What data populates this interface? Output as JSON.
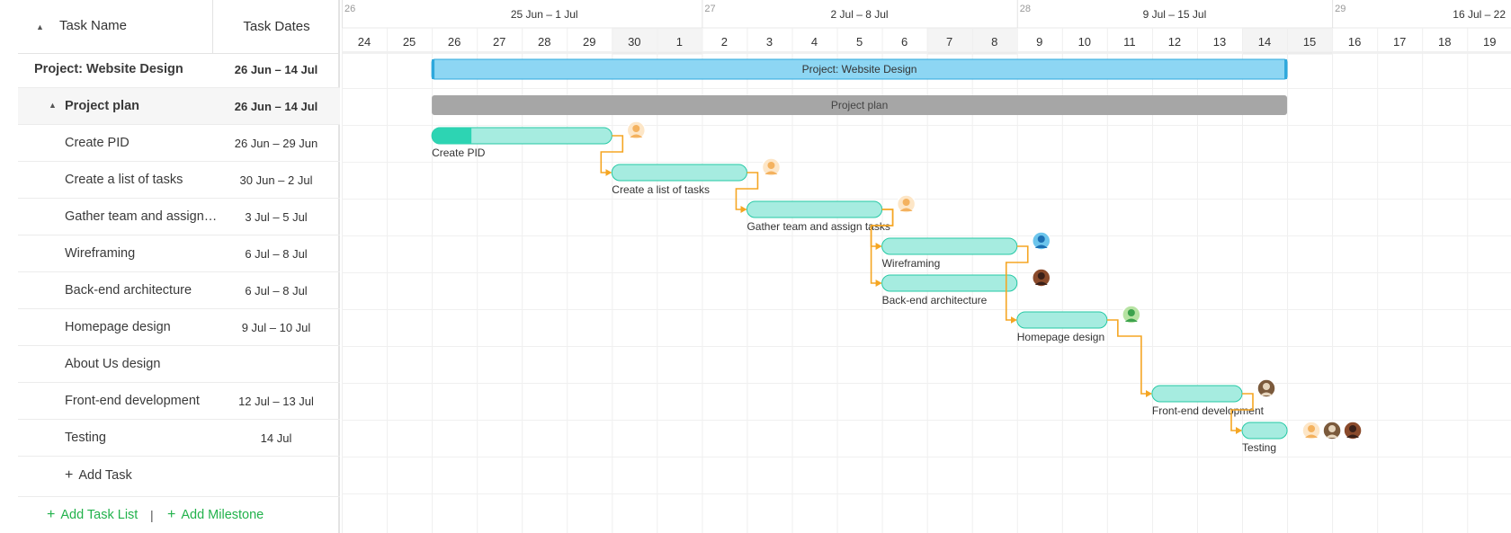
{
  "grid": {
    "collapse_all_icon": "▲",
    "col_name": "Task Name",
    "col_dates": "Task Dates",
    "rows": [
      {
        "name": "Project: Website Design",
        "dates": "26 Jun – 14 Jul",
        "type": "project"
      },
      {
        "name": "Project plan",
        "dates": "26 Jun – 14 Jul",
        "type": "list"
      },
      {
        "name": "Create PID",
        "dates": "26 Jun – 29 Jun",
        "type": "task"
      },
      {
        "name": "Create a list of tasks",
        "dates": "30 Jun – 2 Jul",
        "type": "task"
      },
      {
        "name": "Gather team and assign t...",
        "dates": "3 Jul – 5 Jul",
        "type": "task"
      },
      {
        "name": "Wireframing",
        "dates": "6 Jul – 8 Jul",
        "type": "task"
      },
      {
        "name": "Back-end architecture",
        "dates": "6 Jul – 8 Jul",
        "type": "task"
      },
      {
        "name": "Homepage design",
        "dates": "9 Jul – 10 Jul",
        "type": "task"
      },
      {
        "name": "About Us design",
        "dates": "",
        "type": "task"
      },
      {
        "name": "Front-end development",
        "dates": "12 Jul – 13 Jul",
        "type": "task"
      },
      {
        "name": "Testing",
        "dates": "14 Jul",
        "type": "task"
      }
    ],
    "add_task": "Add Task",
    "add_task_list": "Add Task List",
    "separator": "|",
    "add_milestone": "Add Milestone",
    "plus_icon": "+",
    "collapse_icon": "▲"
  },
  "timeline": {
    "weeks": [
      {
        "num": "26",
        "label": "",
        "start_day": "24 Jun"
      },
      {
        "num": "",
        "label": "25 Jun – 1 Jul",
        "start_day": "25 Jun"
      },
      {
        "num": "27",
        "label": "2 Jul – 8 Jul",
        "start_day": "2 Jul"
      },
      {
        "num": "28",
        "label": "9 Jul – 15 Jul",
        "start_day": "9 Jul"
      },
      {
        "num": "29",
        "label": "16 Jul – 22",
        "start_day": "16 Jul"
      }
    ],
    "days": [
      "24",
      "25",
      "26",
      "27",
      "28",
      "29",
      "30",
      "1",
      "2",
      "3",
      "4",
      "5",
      "6",
      "7",
      "8",
      "9",
      "10",
      "11",
      "12",
      "13",
      "14",
      "15",
      "16",
      "17",
      "18",
      "19"
    ],
    "weekend_days": [
      "30",
      "1",
      "7",
      "8",
      "14",
      "15"
    ],
    "bars": [
      {
        "row": 0,
        "kind": "project",
        "start": "26 Jun",
        "end": "14 Jul",
        "label": "Project: Website Design"
      },
      {
        "row": 1,
        "kind": "list",
        "start": "26 Jun",
        "end": "14 Jul",
        "label": "Project plan"
      },
      {
        "row": 2,
        "kind": "task",
        "start": "26 Jun",
        "end": "29 Jun",
        "label": "Create PID",
        "progress": 0.22,
        "avatars": [
          "avatar-1"
        ]
      },
      {
        "row": 3,
        "kind": "task",
        "start": "30 Jun",
        "end": "2 Jul",
        "label": "Create a list of tasks",
        "progress": 0,
        "avatars": [
          "avatar-1"
        ]
      },
      {
        "row": 4,
        "kind": "task",
        "start": "3 Jul",
        "end": "5 Jul",
        "label": "Gather team and assign tasks",
        "progress": 0,
        "avatars": [
          "avatar-1"
        ]
      },
      {
        "row": 5,
        "kind": "task",
        "start": "6 Jul",
        "end": "8 Jul",
        "label": "Wireframing",
        "progress": 0,
        "avatars": [
          "avatar-2"
        ]
      },
      {
        "row": 6,
        "kind": "task",
        "start": "6 Jul",
        "end": "8 Jul",
        "label": "Back-end architecture",
        "progress": 0,
        "avatars": [
          "avatar-3"
        ]
      },
      {
        "row": 7,
        "kind": "task",
        "start": "9 Jul",
        "end": "10 Jul",
        "label": "Homepage design",
        "progress": 0,
        "avatars": [
          "avatar-4"
        ]
      },
      {
        "row": 9,
        "kind": "task",
        "start": "12 Jul",
        "end": "13 Jul",
        "label": "Front-end development",
        "progress": 0,
        "avatars": [
          "avatar-5"
        ]
      },
      {
        "row": 10,
        "kind": "task",
        "start": "14 Jul",
        "end": "14 Jul",
        "label": "Testing",
        "progress": 0,
        "avatars": [
          "avatar-1",
          "avatar-5",
          "avatar-3"
        ]
      }
    ],
    "links": [
      {
        "from": 2,
        "to": 3
      },
      {
        "from": 3,
        "to": 4
      },
      {
        "from": 4,
        "to": 5
      },
      {
        "from": 4,
        "to": 6
      },
      {
        "from": 5,
        "to": 7
      },
      {
        "from": 7,
        "to": 9
      },
      {
        "from": 9,
        "to": 10
      }
    ]
  },
  "colors": {
    "project_bar": "#8dd6f3",
    "project_border": "#2ea8dc",
    "list_bar": "#a6a6a6",
    "task_bar": "#a6ece0",
    "task_border": "#26c9a5",
    "task_progress": "#2dd4b3",
    "link": "#f5a623",
    "accent_green": "#22b24c"
  }
}
